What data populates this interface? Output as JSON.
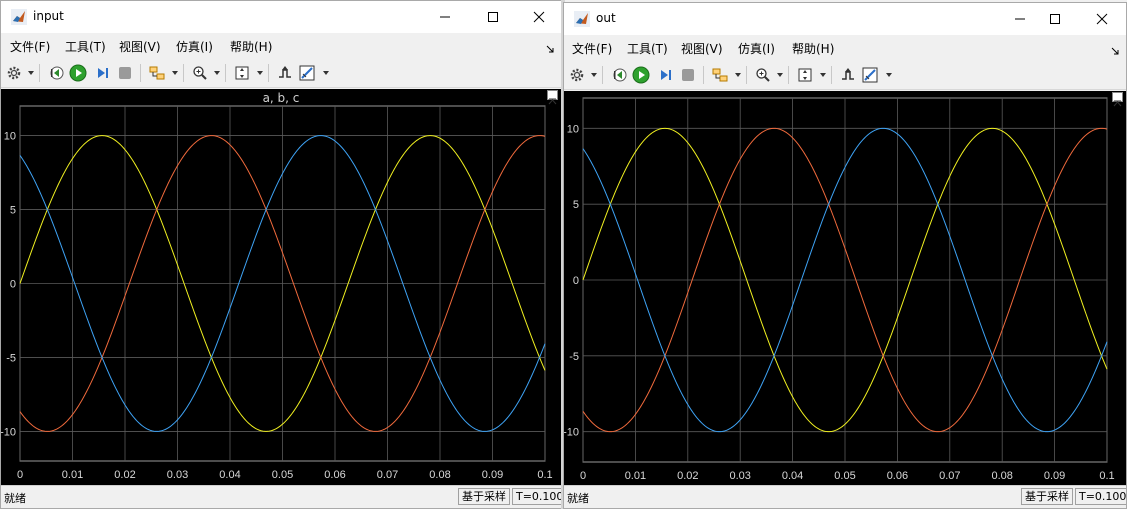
{
  "windows": [
    {
      "title": "input",
      "menus": [
        "文件(F)",
        "工具(T)",
        "视图(V)",
        "仿真(I)",
        "帮助(H)"
      ],
      "plot_title": "a, b, c",
      "status": "就绪",
      "sample_mode": "基于采样",
      "time": "T=0.100"
    },
    {
      "title": "out",
      "menus": [
        "文件(F)",
        "工具(T)",
        "视图(V)",
        "仿真(I)",
        "帮助(H)"
      ],
      "plot_title": "",
      "status": "就绪",
      "sample_mode": "基于采样",
      "time": "T=0.100"
    }
  ],
  "colors": {
    "series_a": "#f0f020",
    "series_b": "#f06a3c",
    "series_c": "#3ea3f5",
    "plot_bg": "#000000",
    "grid": "#5a5a5a",
    "ticks": "#d8d8d8"
  },
  "chart_data": [
    {
      "type": "line",
      "title": "a, b, c",
      "xlim": [
        0,
        0.1
      ],
      "ylim": [
        -12,
        12
      ],
      "x_ticks": [
        "0",
        "0.01",
        "0.02",
        "0.03",
        "0.04",
        "0.05",
        "0.06",
        "0.07",
        "0.08",
        "0.09",
        "0.1"
      ],
      "y_ticks": [
        "10",
        "5",
        "0",
        "-5",
        "-10"
      ],
      "grid": true,
      "series": [
        {
          "amplitude": 10,
          "frequency_hz": 16,
          "phase_deg": 0,
          "color": "#f0f020"
        },
        {
          "amplitude": 10,
          "frequency_hz": 16,
          "phase_deg": -120,
          "color": "#f06a3c"
        },
        {
          "amplitude": 10,
          "frequency_hz": 16,
          "phase_deg": 120,
          "color": "#3ea3f5"
        }
      ]
    },
    {
      "type": "line",
      "title": "",
      "xlim": [
        0,
        0.1
      ],
      "ylim": [
        -12,
        12
      ],
      "x_ticks": [
        "0",
        "0.01",
        "0.02",
        "0.03",
        "0.04",
        "0.05",
        "0.06",
        "0.07",
        "0.08",
        "0.09",
        "0.1"
      ],
      "y_ticks": [
        "10",
        "5",
        "0",
        "-5",
        "-10"
      ],
      "grid": true,
      "series": [
        {
          "amplitude": 10,
          "frequency_hz": 16,
          "phase_deg": 0,
          "color": "#f0f020"
        },
        {
          "amplitude": 10,
          "frequency_hz": 16,
          "phase_deg": -120,
          "color": "#f06a3c"
        },
        {
          "amplitude": 10,
          "frequency_hz": 16,
          "phase_deg": 120,
          "color": "#3ea3f5"
        }
      ]
    }
  ]
}
